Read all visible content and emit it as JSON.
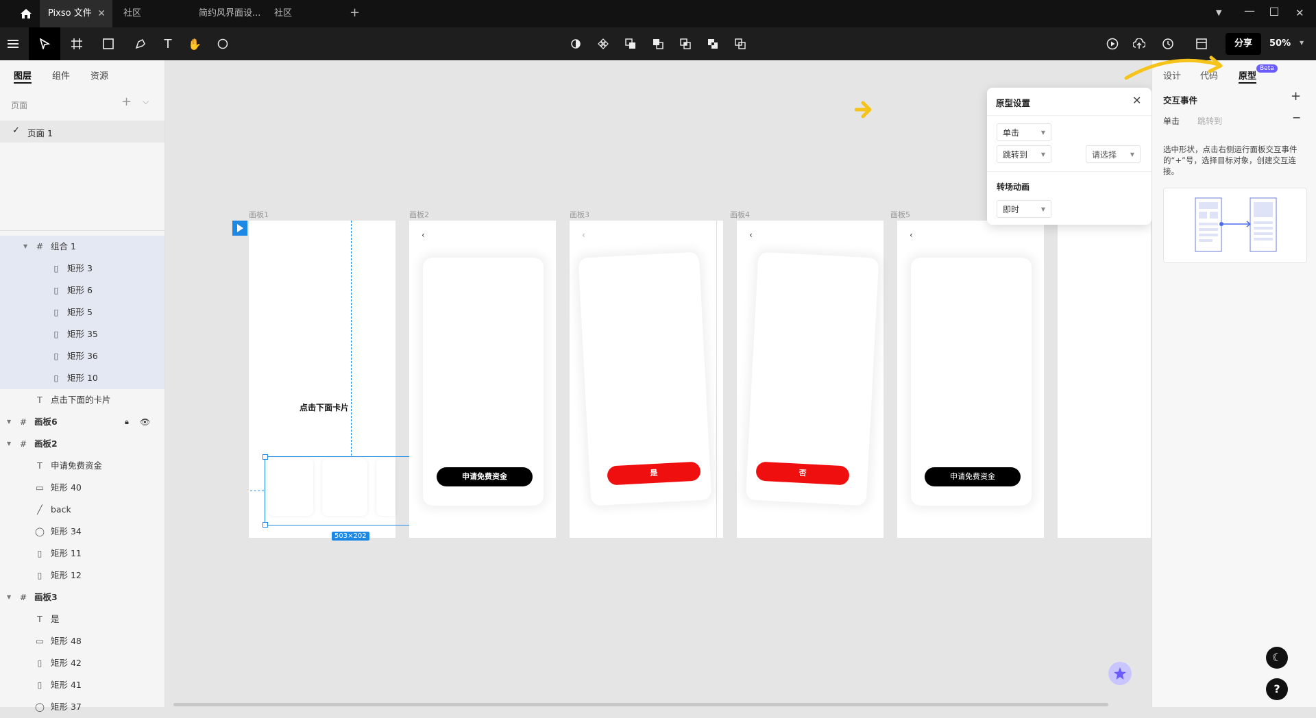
{
  "titlebar": {
    "home_icon": "home-icon",
    "tabs": [
      {
        "label": "Pixso 文件",
        "active": true
      },
      {
        "label": "社区",
        "active": false
      },
      {
        "label": "简约风界面设...",
        "active": false
      },
      {
        "label": "社区",
        "active": false
      }
    ],
    "add_tab": "+"
  },
  "toolbar": {
    "share_label": "分享",
    "zoom": "50%"
  },
  "left_panel": {
    "tabs": [
      "图层",
      "组件",
      "资源"
    ],
    "pages_label": "页面",
    "pages": [
      "页面 1"
    ],
    "layers": [
      {
        "label": "组合 1",
        "icon": "frame-icon",
        "level": 1,
        "hl": true
      },
      {
        "label": "矩形 3",
        "icon": "rect-icon",
        "level": 2,
        "hl": true
      },
      {
        "label": "矩形 6",
        "icon": "rect-icon",
        "level": 2,
        "hl": true
      },
      {
        "label": "矩形 5",
        "icon": "rect-icon",
        "level": 2,
        "hl": true
      },
      {
        "label": "矩形 35",
        "icon": "rect-icon",
        "level": 2,
        "hl": true
      },
      {
        "label": "矩形 36",
        "icon": "rect-icon",
        "level": 2,
        "hl": true
      },
      {
        "label": "矩形 10",
        "icon": "rect-icon",
        "level": 2,
        "hl": true
      },
      {
        "label": "点击下面的卡片",
        "icon": "text-icon",
        "level": 1,
        "hl": false
      },
      {
        "label": "画板6",
        "icon": "frame-icon",
        "level": 0,
        "hl": false,
        "bold": true
      },
      {
        "label": "画板2",
        "icon": "frame-icon",
        "level": 0,
        "hl": false,
        "bold": true
      },
      {
        "label": "申请免费资金",
        "icon": "text-icon",
        "level": 1,
        "hl": false
      },
      {
        "label": "矩形 40",
        "icon": "line-rect-icon",
        "level": 1,
        "hl": false
      },
      {
        "label": "back",
        "icon": "vector-icon",
        "level": 1,
        "hl": false
      },
      {
        "label": "矩形 34",
        "icon": "round-rect-icon",
        "level": 1,
        "hl": false
      },
      {
        "label": "矩形 11",
        "icon": "tall-rect-icon",
        "level": 1,
        "hl": false
      },
      {
        "label": "矩形 12",
        "icon": "tall-rect-icon",
        "level": 1,
        "hl": false
      },
      {
        "label": "画板3",
        "icon": "frame-icon",
        "level": 0,
        "hl": false,
        "bold": true
      },
      {
        "label": "是",
        "icon": "text-icon",
        "level": 1,
        "hl": false
      },
      {
        "label": "矩形 48",
        "icon": "line-rect-icon",
        "level": 1,
        "hl": false
      },
      {
        "label": "矩形 42",
        "icon": "tall-rect-icon",
        "level": 1,
        "hl": false
      },
      {
        "label": "矩形 41",
        "icon": "tall-rect-icon",
        "level": 1,
        "hl": false
      },
      {
        "label": "矩形 37",
        "icon": "round-rect-icon",
        "level": 1,
        "hl": false
      }
    ]
  },
  "canvas": {
    "frames": [
      "画板1",
      "画板2",
      "画板3",
      "画板4",
      "画板5"
    ],
    "frame1_text": "点击下面卡片",
    "selection_size": "503×202",
    "btn_apply": "申请免费资金",
    "btn_yes": "是",
    "btn_no": "否",
    "accent": "#1e88e5",
    "red": "#f00f0f"
  },
  "popup": {
    "title": "原型设置",
    "trigger": "单击",
    "action": "跳转到",
    "target_placeholder": "请选择",
    "transition_title": "转场动画",
    "transition": "即时"
  },
  "right_panel": {
    "tabs": [
      "设计",
      "代码",
      "原型"
    ],
    "beta": "Beta",
    "interaction_title": "交互事件",
    "trigger": "单击",
    "action": "跳转到",
    "hint": "选中形状，点击右侧运行面板交互事件的“+”号，选择目标对象，创建交互连接。"
  }
}
